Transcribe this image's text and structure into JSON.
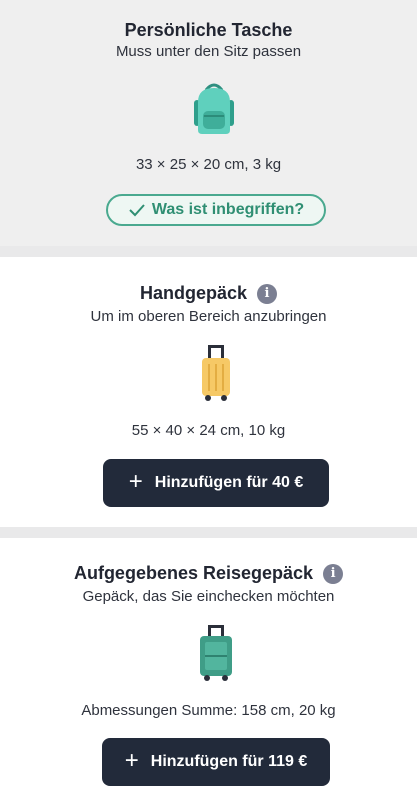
{
  "personal_bag": {
    "title": "Persönliche Tasche",
    "subtitle": "Muss unter den Sitz passen",
    "dimensions": "33 × 25 × 20 cm, 3 kg",
    "included_label": "Was ist inbegriffen?"
  },
  "cabin_bag": {
    "title": "Handgepäck",
    "subtitle": "Um im oberen Bereich anzubringen",
    "dimensions": "55 × 40 × 24 cm, 10 kg",
    "add_label": "Hinzufügen für 40 €"
  },
  "checked_bag": {
    "title": "Aufgegebenes Reisegepäck",
    "subtitle": "Gepäck, das Sie einchecken möchten",
    "dimensions": "Abmessungen Summe: 158 cm, 20 kg",
    "add_label": "Hinzufügen für 119 €"
  },
  "icons": {
    "info": "i",
    "plus": "+",
    "check": "check-icon",
    "backpack": "backpack-icon",
    "cabin_suitcase": "cabin-suitcase-icon",
    "checked_suitcase": "checked-suitcase-icon"
  },
  "colors": {
    "teal": "#4fc7b2",
    "dark_button": "#222a3a",
    "yellow": "#f6c966",
    "green_suitcase": "#3f9d87"
  }
}
